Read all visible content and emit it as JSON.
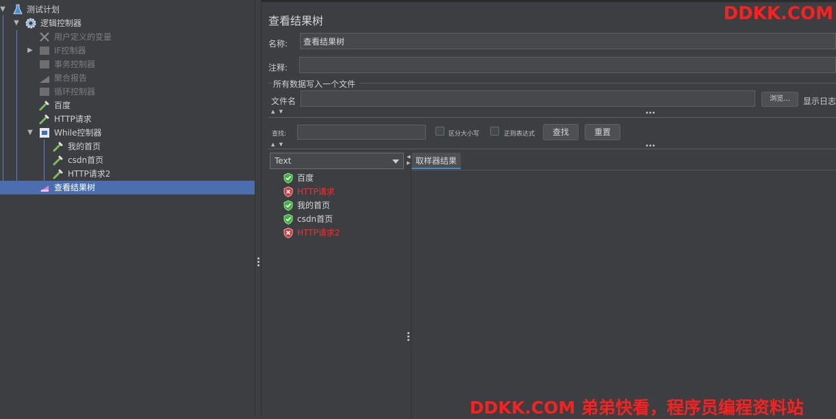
{
  "tree": {
    "items": [
      {
        "label": "测试计划",
        "icon": "flask-icon",
        "arrow": "down",
        "disabled": false
      },
      {
        "label": "逻辑控制器",
        "icon": "gear-icon",
        "arrow": "down",
        "disabled": false
      },
      {
        "label": "用户定义的变量",
        "icon": "tools-icon",
        "arrow": "",
        "disabled": true
      },
      {
        "label": "IF控制器",
        "icon": "controller-icon",
        "arrow": "right",
        "disabled": true
      },
      {
        "label": "事务控制器",
        "icon": "controller-icon",
        "arrow": "",
        "disabled": true
      },
      {
        "label": "聚合报告",
        "icon": "chart-icon",
        "arrow": "",
        "disabled": true
      },
      {
        "label": "循环控制器",
        "icon": "controller-icon",
        "arrow": "",
        "disabled": true
      },
      {
        "label": "百度",
        "icon": "pipette-icon",
        "arrow": "",
        "disabled": false
      },
      {
        "label": "HTTP请求",
        "icon": "pipette-icon",
        "arrow": "",
        "disabled": false
      },
      {
        "label": "While控制器",
        "icon": "while-icon",
        "arrow": "down",
        "disabled": false
      },
      {
        "label": "我的首页",
        "icon": "pipette-icon",
        "arrow": "",
        "disabled": false
      },
      {
        "label": "csdn首页",
        "icon": "pipette-icon",
        "arrow": "",
        "disabled": false
      },
      {
        "label": "HTTP请求2",
        "icon": "pipette-icon",
        "arrow": "",
        "disabled": false
      },
      {
        "label": "查看结果树",
        "icon": "listener-icon",
        "arrow": "",
        "disabled": false,
        "selected": true
      }
    ]
  },
  "panel": {
    "title": "查看结果树",
    "name_label": "名称:",
    "name_value": "查看结果树",
    "comment_label": "注释:",
    "comment_value": "",
    "file_group_title": "所有数据写入一个文件",
    "filename_label": "文件名",
    "filename_value": "",
    "browse_label": "浏览...",
    "show_log_label": "显示日志",
    "search_label": "查找:",
    "search_value": "",
    "case_sensitive_label": "区分大小写",
    "regex_label": "正则表达式",
    "find_button": "查找",
    "reset_button": "重置",
    "renderer_selected": "Text",
    "results_tab": "取样器结果",
    "results": [
      {
        "label": "百度",
        "status": "success"
      },
      {
        "label": "HTTP请求",
        "status": "error"
      },
      {
        "label": "我的首页",
        "status": "success"
      },
      {
        "label": "csdn首页",
        "status": "success"
      },
      {
        "label": "HTTP请求2",
        "status": "error"
      }
    ]
  },
  "watermarks": {
    "top_right": "DDKK.COM",
    "bottom": "DDKK.COM 弟弟快看，程序员编程资料站"
  },
  "colors": {
    "background": "#3c3f41",
    "selection": "#4b6eaf",
    "error_text": "#ff2a2a",
    "success_icon": "#3cb33c",
    "error_icon": "#d23a3a",
    "watermark": "#ff1f1f"
  }
}
